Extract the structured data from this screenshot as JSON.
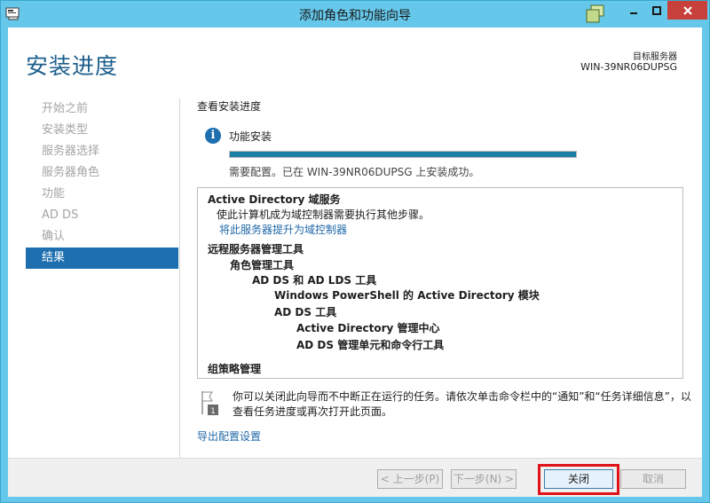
{
  "window": {
    "title": "添加角色和功能向导"
  },
  "header": {
    "page_title": "安装进度",
    "target_label": "目标服务器",
    "target_name": "WIN-39NR06DUPSG"
  },
  "nav": {
    "items": [
      {
        "label": "开始之前",
        "active": false
      },
      {
        "label": "安装类型",
        "active": false
      },
      {
        "label": "服务器选择",
        "active": false
      },
      {
        "label": "服务器角色",
        "active": false
      },
      {
        "label": "功能",
        "active": false
      },
      {
        "label": "AD DS",
        "active": false
      },
      {
        "label": "确认",
        "active": false
      },
      {
        "label": "结果",
        "active": true
      }
    ]
  },
  "content": {
    "section_head": "查看安装进度",
    "feature_label": "功能安装",
    "progress_fraction": 1.0,
    "status": "需要配置。已在 WIN-39NR06DUPSG 上安装成功。",
    "results": [
      {
        "text": "Active Directory 域服务",
        "bold": true,
        "indent": 0
      },
      {
        "text": "使此计算机成为域控制器需要执行其他步骤。",
        "bold": false,
        "indent": 1
      },
      {
        "text": "将此服务器提升为域控制器",
        "bold": false,
        "indent": 1,
        "link": true
      },
      {
        "text": "远程服务器管理工具",
        "bold": true,
        "indent": 0
      },
      {
        "text": "角色管理工具",
        "bold": true,
        "indent": 1
      },
      {
        "text": "AD DS 和 AD LDS 工具",
        "bold": true,
        "indent": 2
      },
      {
        "text": "Windows PowerShell 的 Active Directory 模块",
        "bold": true,
        "indent": 3
      },
      {
        "text": "AD DS 工具",
        "bold": true,
        "indent": 3
      },
      {
        "text": "Active Directory 管理中心",
        "bold": true,
        "indent": 4
      },
      {
        "text": "AD DS 管理单元和命令行工具",
        "bold": true,
        "indent": 4
      },
      {
        "text": "组策略管理",
        "bold": true,
        "indent": 0
      }
    ],
    "note": "你可以关闭此向导而不中断正在运行的任务。请依次单击命令栏中的“通知”和“任务详细信息”，以查看任务进度或再次打开此页面。",
    "note_badge": "1",
    "export_link": "导出配置设置"
  },
  "footer": {
    "prev_label": "< 上一步(P)",
    "next_label": "下一步(N) >",
    "close_label": "关闭",
    "cancel_label": "取消"
  },
  "colors": {
    "accent": "#1d6fb0",
    "title_color": "#1c5e8c",
    "frame": "#65c7e9",
    "highlight": "#e0121a"
  }
}
